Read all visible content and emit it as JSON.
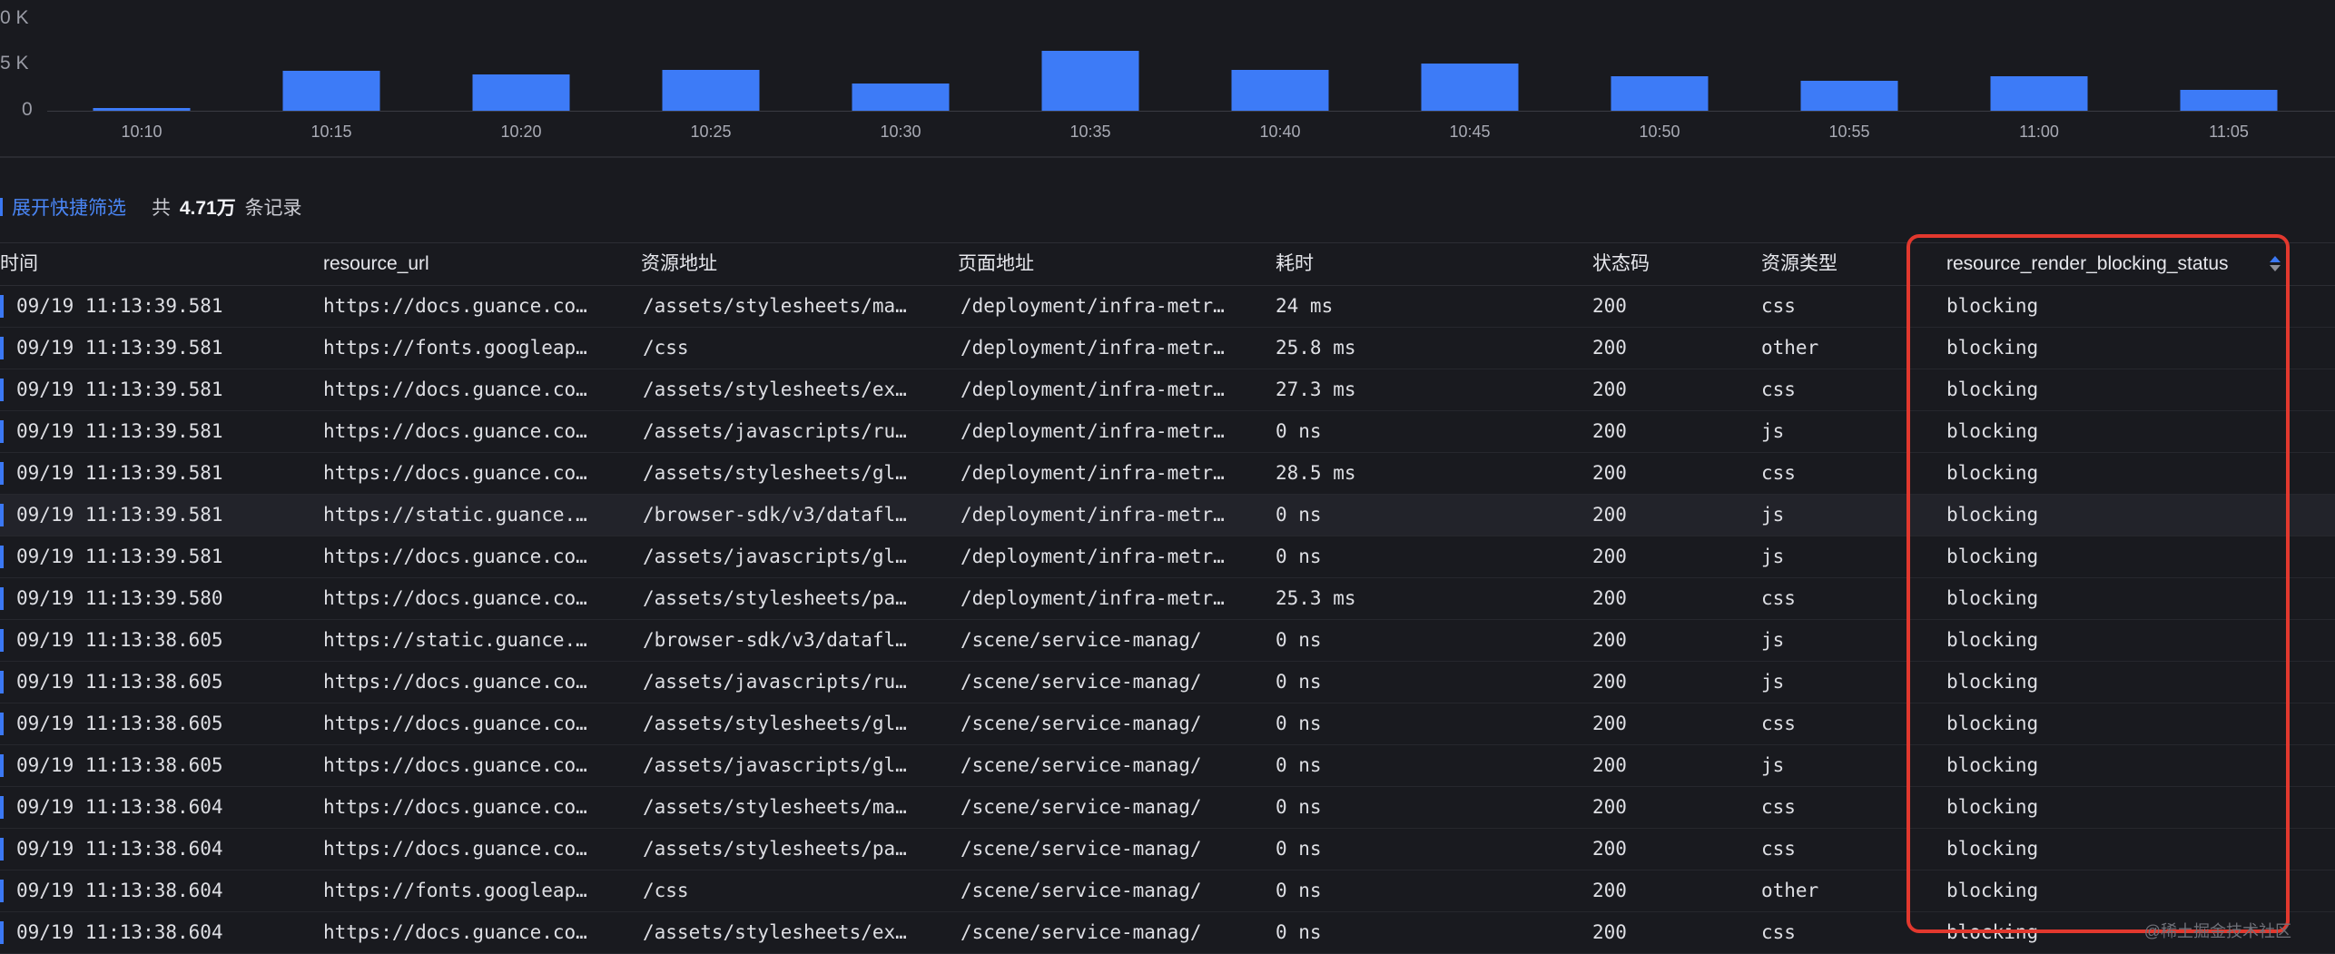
{
  "chart_data": {
    "type": "bar",
    "yticks": [
      "0 K",
      "5 K",
      "0"
    ],
    "categories": [
      "10:10",
      "10:15",
      "10:20",
      "10:25",
      "10:30",
      "10:35",
      "10:40",
      "10:45",
      "10:50",
      "10:55",
      "11:00",
      "11:05"
    ],
    "values": [
      0.3,
      4.4,
      4.0,
      4.5,
      3.0,
      6.6,
      4.5,
      5.2,
      3.8,
      3.3,
      3.8,
      2.3
    ],
    "ylim": [
      0,
      10
    ],
    "bar_color": "#3d7bf7"
  },
  "toolbar": {
    "filter_toggle": "展开快捷筛选",
    "count_prefix": "共",
    "count_value": "4.71万",
    "count_suffix": "条记录"
  },
  "table": {
    "columns": [
      "时间",
      "resource_url",
      "资源地址",
      "页面地址",
      "耗时",
      "状态码",
      "资源类型",
      "resource_render_blocking_status"
    ],
    "rows": [
      [
        "09/19 11:13:39.581",
        "https://docs.guance.co…",
        "/assets/stylesheets/ma…",
        "/deployment/infra-metr…",
        "24 ms",
        "200",
        "css",
        "blocking"
      ],
      [
        "09/19 11:13:39.581",
        "https://fonts.googleap…",
        "/css",
        "/deployment/infra-metr…",
        "25.8 ms",
        "200",
        "other",
        "blocking"
      ],
      [
        "09/19 11:13:39.581",
        "https://docs.guance.co…",
        "/assets/stylesheets/ex…",
        "/deployment/infra-metr…",
        "27.3 ms",
        "200",
        "css",
        "blocking"
      ],
      [
        "09/19 11:13:39.581",
        "https://docs.guance.co…",
        "/assets/javascripts/ru…",
        "/deployment/infra-metr…",
        "0 ns",
        "200",
        "js",
        "blocking"
      ],
      [
        "09/19 11:13:39.581",
        "https://docs.guance.co…",
        "/assets/stylesheets/gl…",
        "/deployment/infra-metr…",
        "28.5 ms",
        "200",
        "css",
        "blocking"
      ],
      [
        "09/19 11:13:39.581",
        "https://static.guance.…",
        "/browser-sdk/v3/datafl…",
        "/deployment/infra-metr…",
        "0 ns",
        "200",
        "js",
        "blocking"
      ],
      [
        "09/19 11:13:39.581",
        "https://docs.guance.co…",
        "/assets/javascripts/gl…",
        "/deployment/infra-metr…",
        "0 ns",
        "200",
        "js",
        "blocking"
      ],
      [
        "09/19 11:13:39.580",
        "https://docs.guance.co…",
        "/assets/stylesheets/pa…",
        "/deployment/infra-metr…",
        "25.3 ms",
        "200",
        "css",
        "blocking"
      ],
      [
        "09/19 11:13:38.605",
        "https://static.guance.…",
        "/browser-sdk/v3/datafl…",
        "/scene/service-manag/",
        "0 ns",
        "200",
        "js",
        "blocking"
      ],
      [
        "09/19 11:13:38.605",
        "https://docs.guance.co…",
        "/assets/javascripts/ru…",
        "/scene/service-manag/",
        "0 ns",
        "200",
        "js",
        "blocking"
      ],
      [
        "09/19 11:13:38.605",
        "https://docs.guance.co…",
        "/assets/stylesheets/gl…",
        "/scene/service-manag/",
        "0 ns",
        "200",
        "css",
        "blocking"
      ],
      [
        "09/19 11:13:38.605",
        "https://docs.guance.co…",
        "/assets/javascripts/gl…",
        "/scene/service-manag/",
        "0 ns",
        "200",
        "js",
        "blocking"
      ],
      [
        "09/19 11:13:38.604",
        "https://docs.guance.co…",
        "/assets/stylesheets/ma…",
        "/scene/service-manag/",
        "0 ns",
        "200",
        "css",
        "blocking"
      ],
      [
        "09/19 11:13:38.604",
        "https://docs.guance.co…",
        "/assets/stylesheets/pa…",
        "/scene/service-manag/",
        "0 ns",
        "200",
        "css",
        "blocking"
      ],
      [
        "09/19 11:13:38.604",
        "https://fonts.googleap…",
        "/css",
        "/scene/service-manag/",
        "0 ns",
        "200",
        "other",
        "blocking"
      ],
      [
        "09/19 11:13:38.604",
        "https://docs.guance.co…",
        "/assets/stylesheets/ex…",
        "/scene/service-manag/",
        "0 ns",
        "200",
        "css",
        "blocking"
      ]
    ]
  },
  "highlight_color": "#e2382e",
  "watermark": "@稀土掘金技术社区"
}
